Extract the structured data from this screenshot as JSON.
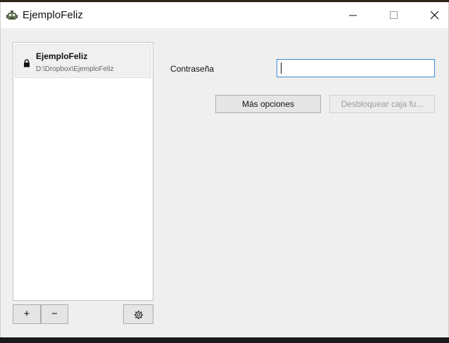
{
  "window": {
    "title": "EjemploFeliz",
    "controls": {
      "minimize_icon": "minimize-icon",
      "maximize_icon": "maximize-icon",
      "close_icon": "close-icon"
    }
  },
  "sidebar": {
    "vaults": [
      {
        "name": "EjemploFeliz",
        "path": "D:\\Dropbox\\EjemploFeliz",
        "icon": "lock-icon"
      }
    ],
    "add_label": "+",
    "remove_label": "−",
    "settings_icon": "gear-icon"
  },
  "unlock_panel": {
    "password_label": "Contraseña",
    "password_value": "",
    "more_options_label": "Más opciones",
    "unlock_label": "Desbloquear caja fu..."
  },
  "colors": {
    "input_focus_border": "#3f8ad8",
    "window_background": "#efefef",
    "disabled_text": "#9a9a9a"
  }
}
